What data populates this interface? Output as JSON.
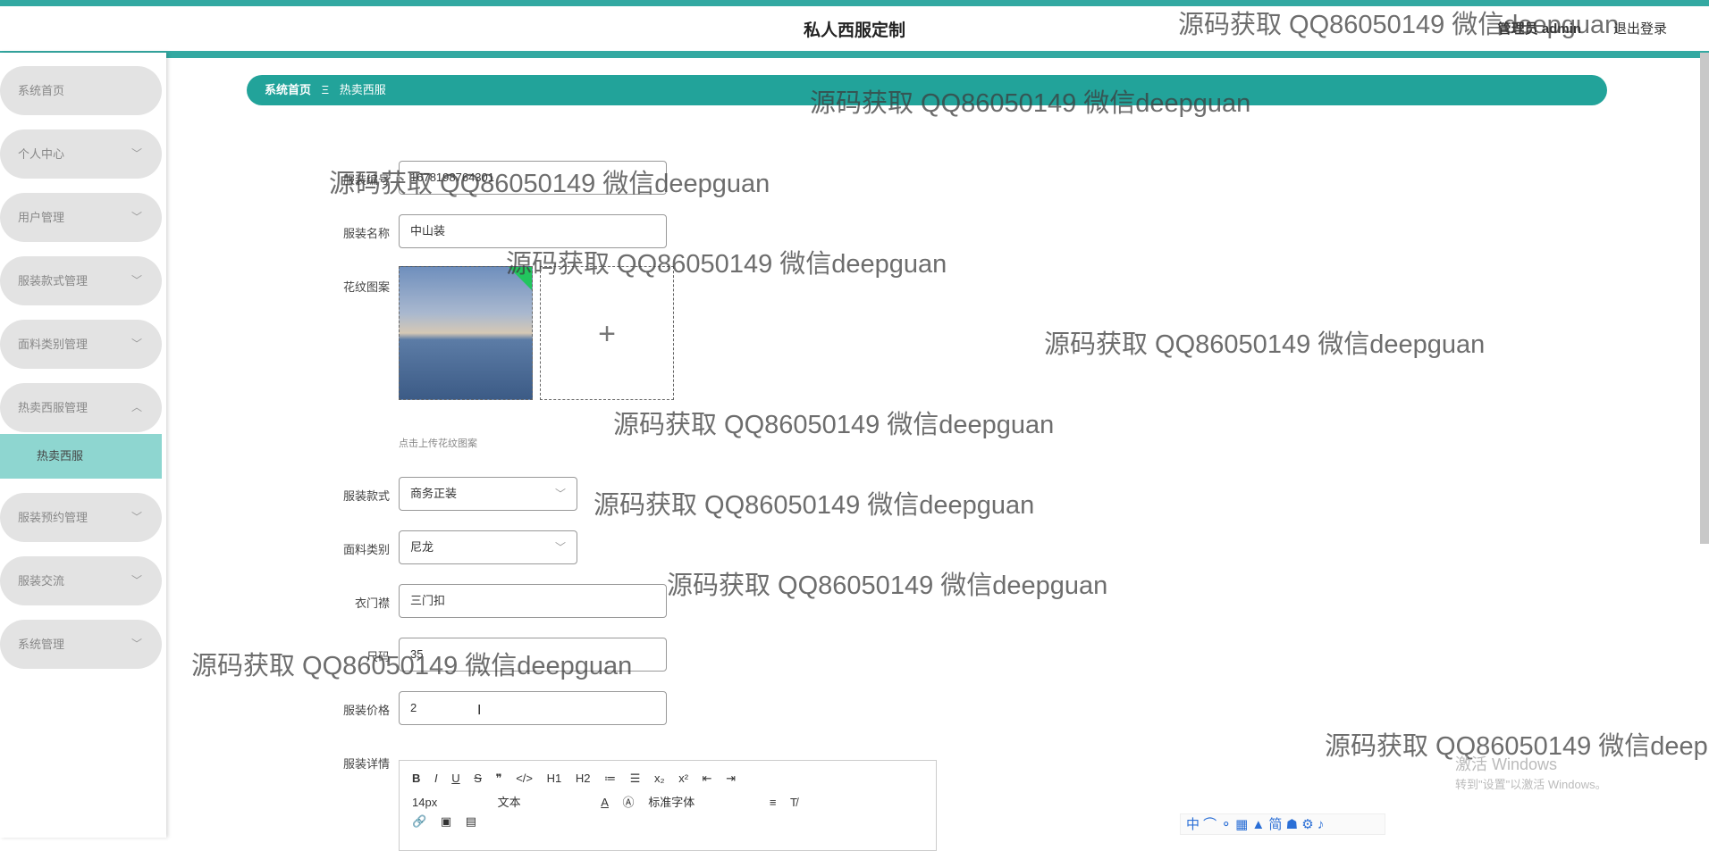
{
  "header": {
    "title": "私人西服定制",
    "admin": "管理员 admin",
    "logout": "退出登录"
  },
  "sidebar": {
    "items": [
      {
        "label": "系统首页",
        "chevron": ""
      },
      {
        "label": "个人中心",
        "chevron": "﹀"
      },
      {
        "label": "用户管理",
        "chevron": "﹀"
      },
      {
        "label": "服装款式管理",
        "chevron": "﹀"
      },
      {
        "label": "面料类别管理",
        "chevron": "﹀"
      },
      {
        "label": "热卖西服管理",
        "chevron": "︿"
      },
      {
        "label": "服装预约管理",
        "chevron": "﹀"
      },
      {
        "label": "服装交流",
        "chevron": "﹀"
      },
      {
        "label": "系统管理",
        "chevron": "﹀"
      }
    ],
    "active_sub": "热卖西服"
  },
  "breadcrumb": {
    "home": "系统首页",
    "separator": "Ξ",
    "current": "热卖西服"
  },
  "form": {
    "code": {
      "label": "服装编号",
      "value": "1678198764301"
    },
    "name": {
      "label": "服装名称",
      "value": "中山装"
    },
    "pattern": {
      "label": "花纹图案",
      "hint": "点击上传花纹图案",
      "add_icon": "+"
    },
    "style": {
      "label": "服装款式",
      "value": "商务正装"
    },
    "fabric": {
      "label": "面料类别",
      "value": "尼龙"
    },
    "placket": {
      "label": "衣门襟",
      "value": "三门扣"
    },
    "size": {
      "label": "尺码",
      "value": "35"
    },
    "price": {
      "label": "服装价格",
      "value": "2"
    },
    "details": {
      "label": "服装详情"
    }
  },
  "editor": {
    "row1": [
      "B",
      "I",
      "U",
      "S",
      "❞",
      "</>",
      "H1",
      "H2",
      "≔",
      "☰",
      "x₂",
      "x²",
      "⇤",
      "⇥"
    ],
    "font_size": "14px",
    "text_type": "文本",
    "font_family": "标准字体",
    "row3": [
      "🔗",
      "▣",
      "▤"
    ]
  },
  "watermark": "源码获取 QQ86050149 微信deepguan",
  "windows": {
    "line1": "激活 Windows",
    "line2": "转到\"设置\"以激活 Windows。"
  },
  "tray": "中 ⌒ ⚬ ▦ ▲ 简 ☗ ⚙ ♪"
}
